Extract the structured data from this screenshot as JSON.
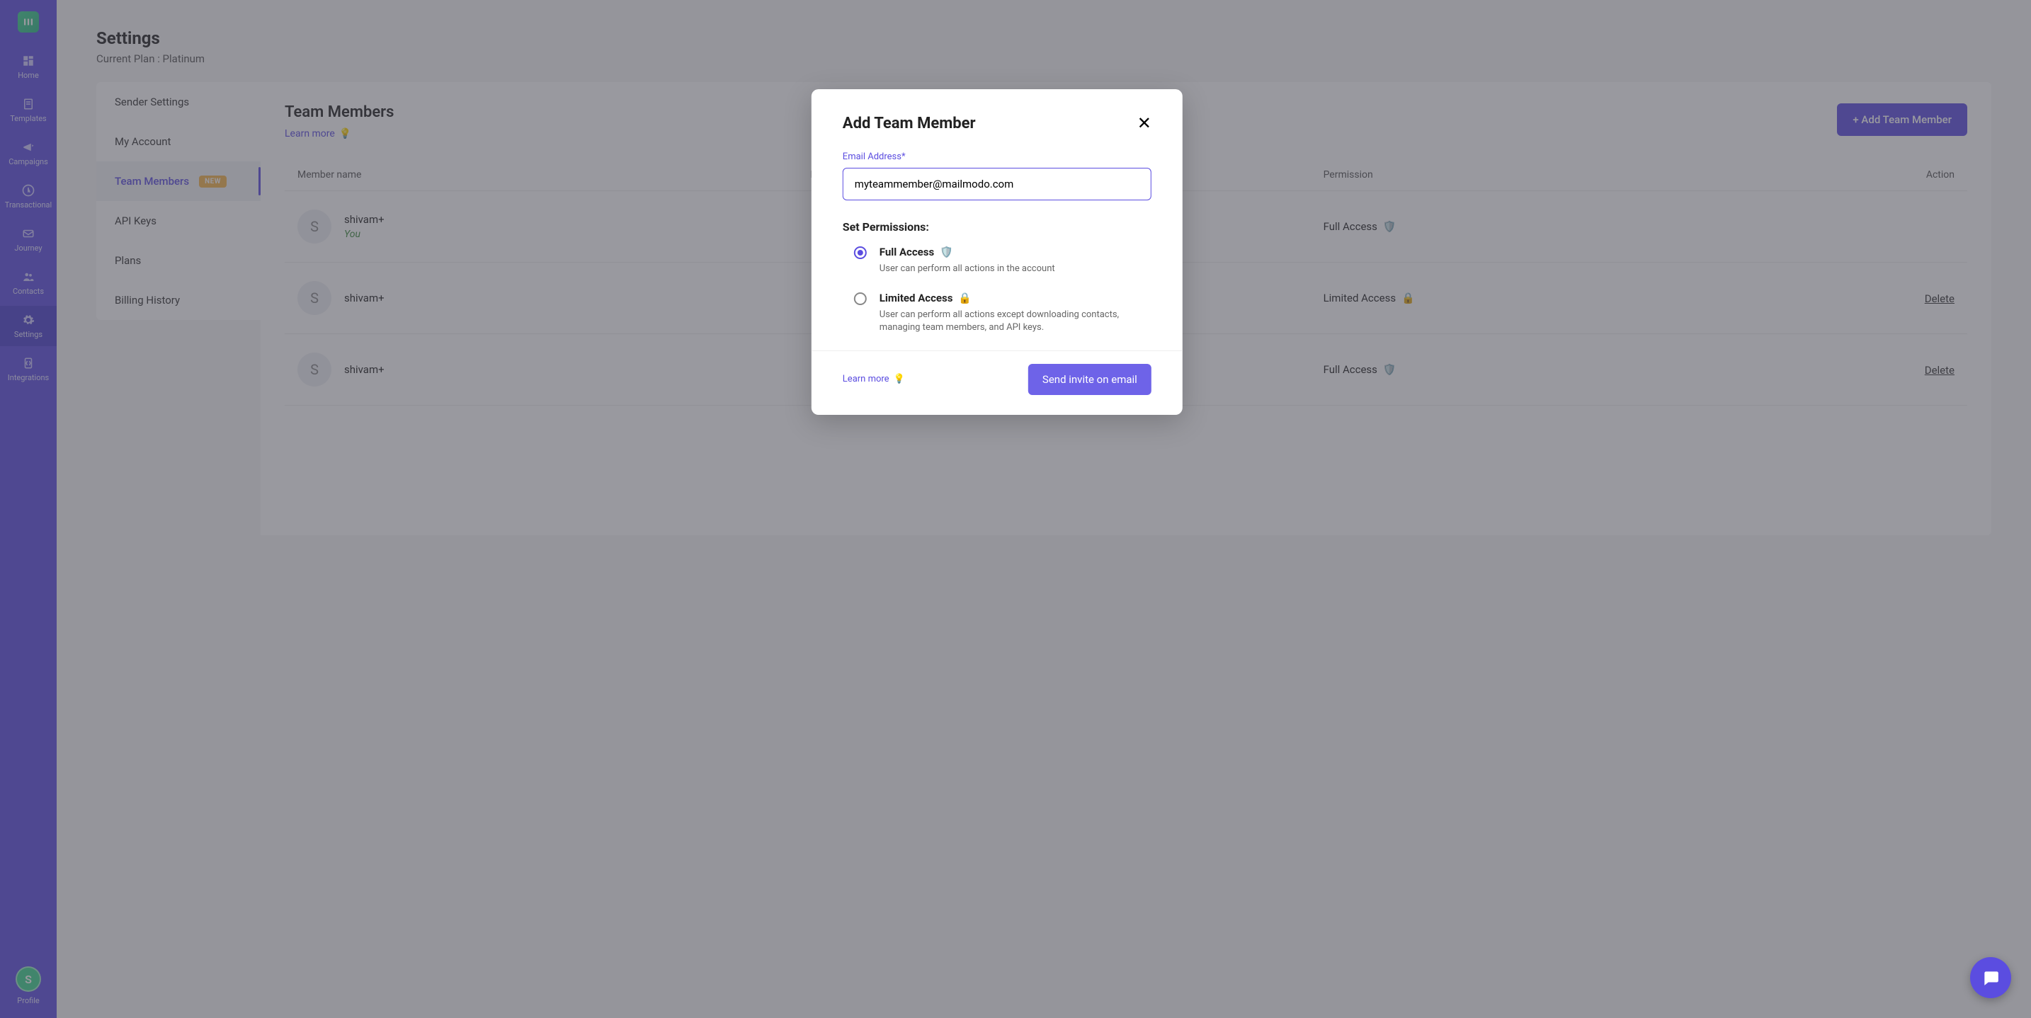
{
  "sidebar": {
    "items": [
      {
        "label": "Home"
      },
      {
        "label": "Templates"
      },
      {
        "label": "Campaigns"
      },
      {
        "label": "Transactional"
      },
      {
        "label": "Journey"
      },
      {
        "label": "Contacts"
      },
      {
        "label": "Settings"
      },
      {
        "label": "Integrations"
      }
    ],
    "profile_label": "Profile",
    "profile_initial": "S"
  },
  "header": {
    "title": "Settings",
    "plan": "Current Plan : Platinum"
  },
  "settings_nav": {
    "items": [
      {
        "label": "Sender Settings"
      },
      {
        "label": "My Account"
      },
      {
        "label": "Team Members",
        "badge": "NEW"
      },
      {
        "label": "API Keys"
      },
      {
        "label": "Plans"
      },
      {
        "label": "Billing History"
      }
    ]
  },
  "panel": {
    "title": "Team Members",
    "learn": "Learn more",
    "add_btn": "+ Add Team Member",
    "cols": {
      "name": "Member name",
      "email": "Email",
      "perm": "Permission",
      "action": "Action"
    },
    "rows": [
      {
        "initial": "S",
        "name": "shivam+",
        "you": "You",
        "perm": "Full Access",
        "perm_icon": "shield",
        "action": ""
      },
      {
        "initial": "S",
        "name": "shivam+",
        "perm": "Limited Access",
        "perm_icon": "lock",
        "action": "Delete"
      },
      {
        "initial": "S",
        "name": "shivam+",
        "perm": "Full Access",
        "perm_icon": "shield",
        "action": "Delete"
      }
    ]
  },
  "modal": {
    "title": "Add Team Member",
    "email_label": "Email Address*",
    "email_value": "myteammember@mailmodo.com",
    "perm_title": "Set Permissions:",
    "options": [
      {
        "label": "Full Access",
        "icon": "🛡️",
        "desc": "User can perform all actions in the account",
        "selected": true
      },
      {
        "label": "Limited Access",
        "icon": "🔒",
        "desc": "User can perform all actions except downloading contacts, managing team members, and API keys.",
        "selected": false
      }
    ],
    "learn": "Learn more",
    "send_btn": "Send invite on email"
  }
}
